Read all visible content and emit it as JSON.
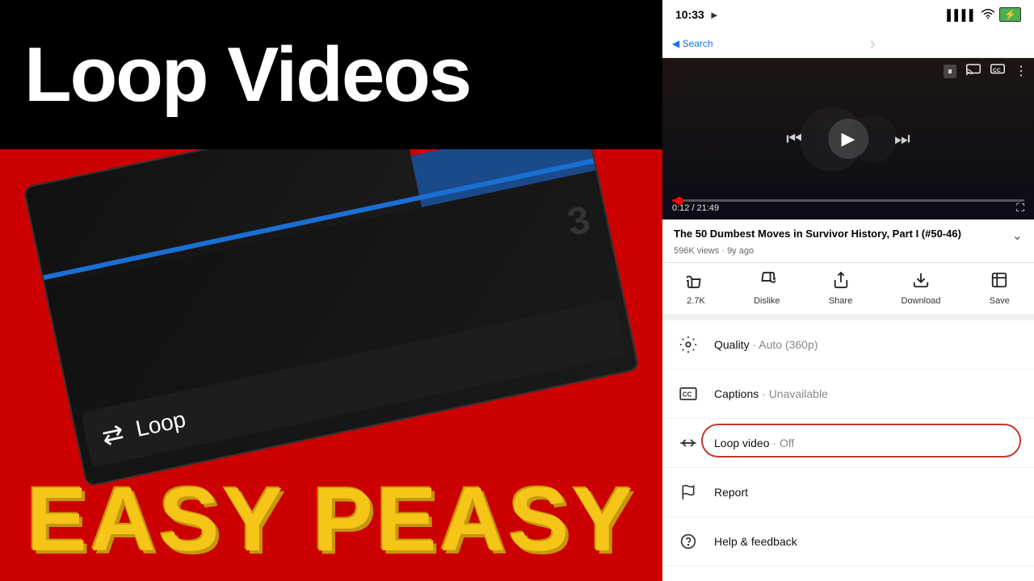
{
  "left": {
    "main_title": "Loop Videos",
    "easy_peasy": "EASY PEASY",
    "loop_label": "Loop"
  },
  "right": {
    "status": {
      "time": "10:33",
      "location_icon": "▶",
      "back_label": "◀ Search",
      "signal": "📶",
      "wifi": "wifi",
      "battery": "🔋"
    },
    "video": {
      "time_current": "0:12",
      "time_total": "21:49"
    },
    "video_info": {
      "title": "The 50 Dumbest Moves in Survivor History, Part I (#50-46)",
      "views": "596K views",
      "age": "9y ago"
    },
    "actions": [
      {
        "icon": "👍",
        "label": "2.7K"
      },
      {
        "icon": "👎",
        "label": "Dislike"
      },
      {
        "icon": "↗",
        "label": "Share"
      },
      {
        "icon": "⬇",
        "label": "Download"
      },
      {
        "icon": "☰+",
        "label": "Save"
      }
    ],
    "menu": [
      {
        "icon": "gear",
        "text": "Quality",
        "value": "· Auto (360p)"
      },
      {
        "icon": "cc",
        "text": "Captions",
        "value": "· Unavailable"
      },
      {
        "icon": "loop",
        "text": "Loop video",
        "value": "· Off"
      },
      {
        "icon": "flag",
        "text": "Report",
        "value": ""
      },
      {
        "icon": "help",
        "text": "Help & feedback",
        "value": ""
      }
    ]
  }
}
